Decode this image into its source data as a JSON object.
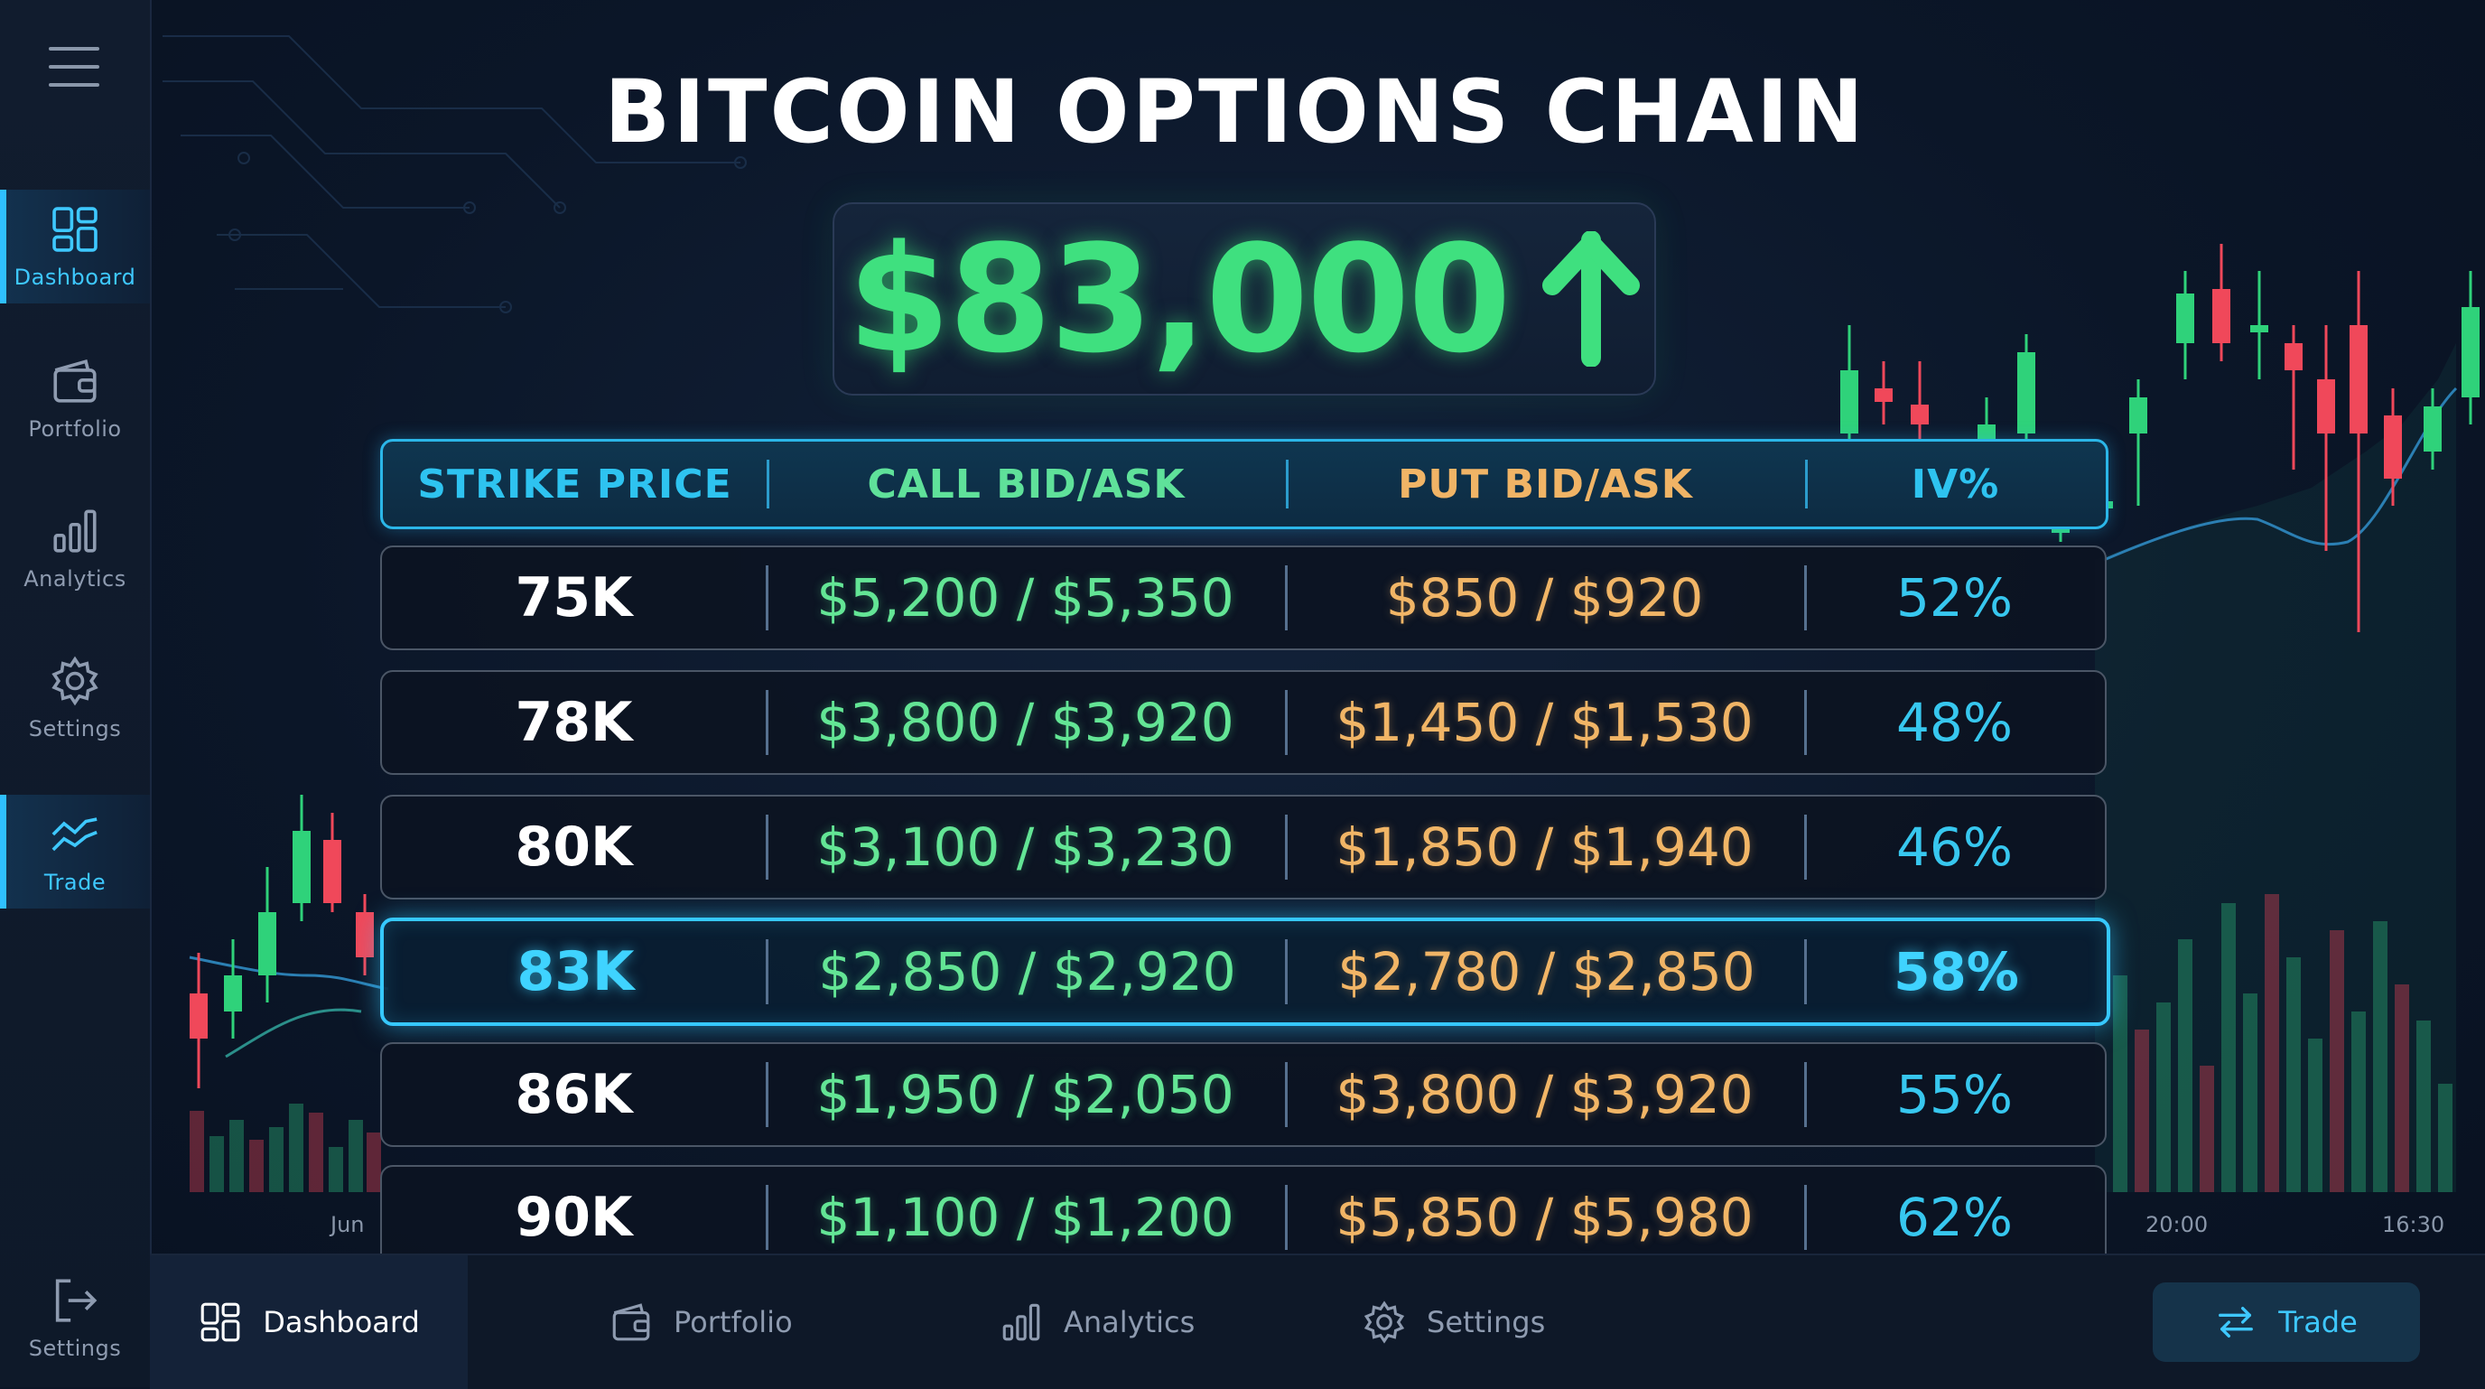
{
  "title": "BITCOIN OPTIONS CHAIN",
  "price": "$83,000",
  "price_direction": "up-arrow-icon",
  "sidebar": {
    "items": [
      {
        "label": "Dashboard",
        "icon": "dashboard-icon",
        "active": true
      },
      {
        "label": "Portfolio",
        "icon": "wallet-icon",
        "active": false
      },
      {
        "label": "Analytics",
        "icon": "bar-chart-icon",
        "active": false
      },
      {
        "label": "Settings",
        "icon": "gear-icon",
        "active": false
      },
      {
        "label": "Trade",
        "icon": "trend-icon",
        "active": true
      }
    ],
    "footer": {
      "label": "Settings",
      "icon": "logout-icon"
    }
  },
  "table": {
    "headers": [
      "STRIKE PRICE",
      "CALL BID/ASK",
      "PUT BID/ASK",
      "IV%"
    ],
    "rows": [
      {
        "strike": "75K",
        "call": "$5,200 / $5,350",
        "put": "$850 / $920",
        "iv": "52%"
      },
      {
        "strike": "78K",
        "call": "$3,800 / $3,920",
        "put": "$1,450 / $1,530",
        "iv": "48%"
      },
      {
        "strike": "80K",
        "call": "$3,100 / $3,230",
        "put": "$1,850 / $1,940",
        "iv": "46%"
      },
      {
        "strike": "83K",
        "call": "$2,850 / $2,920",
        "put": "$2,780 / $2,850",
        "iv": "58%",
        "highlighted": true
      },
      {
        "strike": "86K",
        "call": "$1,950 / $2,050",
        "put": "$3,800 / $3,920",
        "iv": "55%"
      },
      {
        "strike": "90K",
        "call": "$1,100 / $1,200",
        "put": "$5,850 / $5,980",
        "iv": "62%"
      }
    ]
  },
  "chart_axis_labels": [
    "Jun",
    "20:00",
    "16:30"
  ],
  "bottom_nav": {
    "items": [
      {
        "label": "Dashboard",
        "icon": "dashboard-icon",
        "active": true
      },
      {
        "label": "Portfolio",
        "icon": "wallet-icon"
      },
      {
        "label": "Analytics",
        "icon": "bar-chart-icon"
      },
      {
        "label": "Settings",
        "icon": "gear-icon"
      }
    ],
    "trade_button": {
      "label": "Trade",
      "icon": "swap-icon"
    }
  },
  "colors": {
    "accent": "#2fc0ff",
    "call": "#63e595",
    "put": "#f1b566",
    "price": "#3fe07f",
    "bull_candle": "#2fd27a",
    "bear_candle": "#f0485a"
  }
}
